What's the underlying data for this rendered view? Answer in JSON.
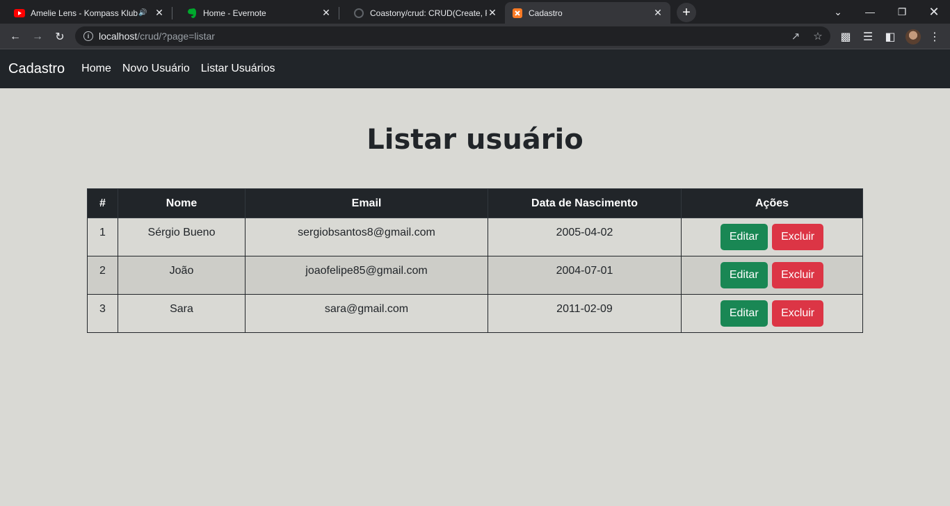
{
  "browser": {
    "tabs": [
      {
        "title": "Amelie Lens - Kompass Klub",
        "favicon": "youtube-icon",
        "audio": true
      },
      {
        "title": "Home - Evernote",
        "favicon": "evernote-icon"
      },
      {
        "title": "Coastony/crud: CRUD(Create, Re",
        "favicon": "github-icon"
      },
      {
        "title": "Cadastro",
        "favicon": "xampp-icon",
        "active": true
      }
    ],
    "url_host": "localhost",
    "url_path": "/crud/?page=listar"
  },
  "navbar": {
    "brand": "Cadastro",
    "links": [
      "Home",
      "Novo Usuário",
      "Listar Usuários"
    ]
  },
  "main": {
    "title": "Listar usuário",
    "table": {
      "headers": [
        "#",
        "Nome",
        "Email",
        "Data de Nascimento",
        "Ações"
      ],
      "rows": [
        {
          "id": "1",
          "nome": "Sérgio Bueno",
          "email": "sergiobsantos8@gmail.com",
          "nascimento": "2005-04-02"
        },
        {
          "id": "2",
          "nome": "João",
          "email": "joaofelipe85@gmail.com",
          "nascimento": "2004-07-01"
        },
        {
          "id": "3",
          "nome": "Sara",
          "email": "sara@gmail.com",
          "nascimento": "2011-02-09"
        }
      ],
      "edit_label": "Editar",
      "delete_label": "Excluir"
    }
  },
  "colors": {
    "navbar_bg": "#212529",
    "page_bg": "#d9d9d4",
    "edit_button": "#198754",
    "delete_button": "#dc3545"
  }
}
